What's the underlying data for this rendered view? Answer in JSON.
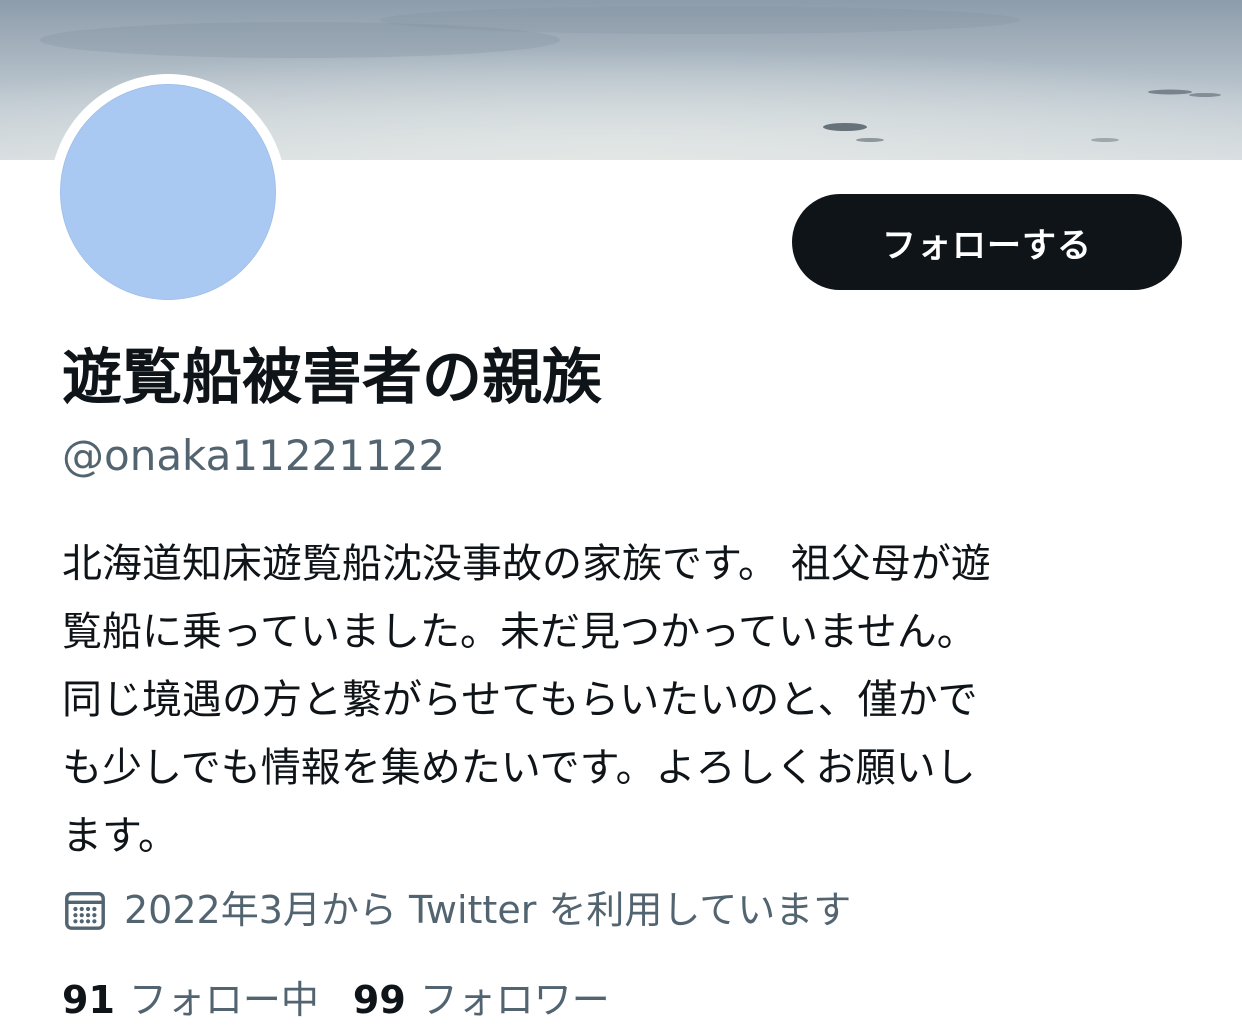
{
  "profile": {
    "follow_label": "フォローする",
    "display_name": "遊覧船被害者の親族",
    "handle": "@onaka11221122",
    "bio_lines": [
      "北海道知床遊覧船沈没事故の家族です。 祖父母が遊",
      "覧船に乗っていました。未だ見つかっていません。",
      "同じ境遇の方と繋がらせてもらいたいのと、僅かで",
      "も少しでも情報を集めたいです。よろしくお願いし",
      "ます。"
    ],
    "joined": "2022年3月から Twitter を利用しています",
    "joined_icon": "calendar-icon",
    "following_count": "91",
    "following_label": "フォロー中",
    "followers_count": "99",
    "followers_label": "フォロワー"
  },
  "colors": {
    "avatar": "#a9c8f2",
    "button": "#0f1419",
    "secondary_text": "#536471"
  }
}
